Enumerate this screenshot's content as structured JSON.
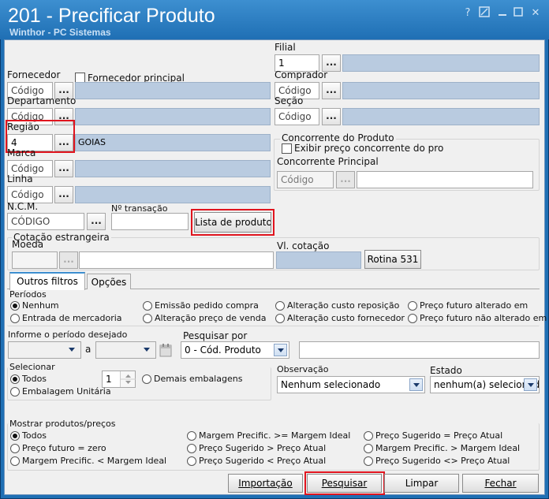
{
  "window": {
    "title": "201 - Precificar Produto",
    "subtitle": "Winthor - PC Sistemas",
    "help_glyph": "?",
    "close_glyph": "✕"
  },
  "filters": {
    "filial_label": "Filial",
    "filial_value": "1",
    "fornecedor_label": "Fornecedor",
    "fornecedor_placeholder": "Código",
    "fornecedor_principal_label": "Fornecedor principal",
    "comprador_label": "Comprador",
    "comprador_placeholder": "Código",
    "departamento_label": "Departamento",
    "departamento_placeholder": "Código",
    "secao_label": "Seção",
    "secao_placeholder": "Código",
    "regiao_label": "Região",
    "regiao_value": "4",
    "regiao_name": "GOIAS",
    "marca_label": "Marca",
    "marca_placeholder": "Código",
    "linha_label": "Linha",
    "linha_placeholder": "Código",
    "ncm_label": "N.C.M.",
    "ncm_placeholder": "CÓDIGO",
    "transacao_label": "Nº transação",
    "lista_produtos_label": "Lista de produtos",
    "browse_label": "..."
  },
  "concorrente": {
    "group_label": "Concorrente do Produto",
    "exibir_label": "Exibir preço concorrente do pro",
    "principal_label": "Concorrente Principal",
    "principal_placeholder": "Código"
  },
  "cotacao": {
    "group_label": "Cotação estrangeira",
    "moeda_label": "Moeda",
    "vl_cotacao_label": "Vl. cotação",
    "rotina_button": "Rotina 531"
  },
  "tabs": {
    "outros_filtros": "Outros filtros",
    "opcoes": "Opções"
  },
  "periodos": {
    "label": "Períodos",
    "options": [
      "Nenhum",
      "Emissão pedido compra",
      "Alteração custo reposição",
      "Preço futuro alterado em",
      "Entrada de mercadoria",
      "Alteração preço de venda",
      "Alteração custo fornecedor",
      "Preço futuro não alterado em"
    ],
    "selected": "Nenhum"
  },
  "periodo_desejado": {
    "label": "Informe o período desejado",
    "separator": "a"
  },
  "pesquisar_por": {
    "label": "Pesquisar por",
    "value": "0 - Cód. Produto"
  },
  "selecionar": {
    "label": "Selecionar",
    "todos": "Todos",
    "embalagem_unitaria": "Embalagem Unitária",
    "spin_value": "1",
    "demais_embalagens": "Demais embalagens"
  },
  "observacao": {
    "label": "Observação",
    "value": "Nenhum selecionado"
  },
  "estado": {
    "label": "Estado",
    "value": "nenhum(a) selecionado"
  },
  "mostrar": {
    "label": "Mostrar produtos/preços",
    "options": [
      "Todos",
      "Margem Precific. >= Margem Ideal",
      "Preço Sugerido = Preço Atual",
      "Preço futuro = zero",
      "Preço Sugerido > Preço Atual",
      "Margem Precific. > Margem Ideal",
      "Margem Precific. < Margem Ideal",
      "Preço Sugerido < Preço Atual",
      "Preço Sugerido <> Preço Atual"
    ],
    "selected": "Todos"
  },
  "footer": {
    "importacao": "Importação",
    "pesquisar": "Pesquisar",
    "limpar": "Limpar",
    "fechar": "Fechar"
  },
  "colors": {
    "title_bar": "#1f6fb4",
    "readonly_field": "#b9cbe0",
    "highlight": "#e0141e"
  }
}
